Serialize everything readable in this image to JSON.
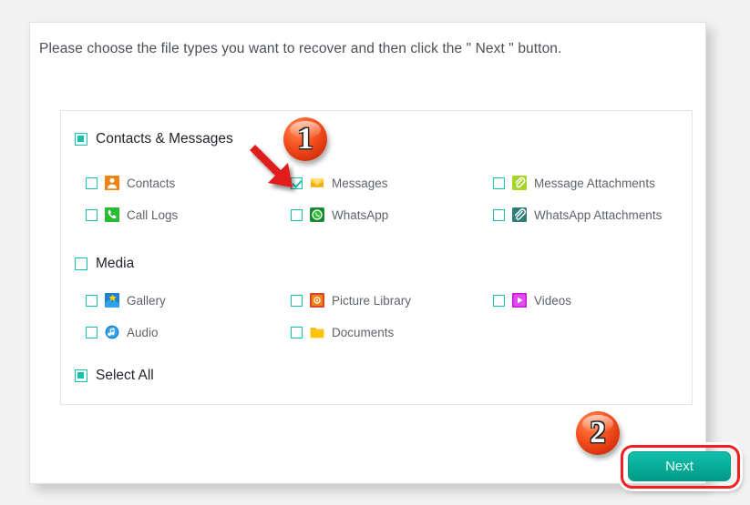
{
  "instruction": "Please choose the file types you want to recover and then click the \" Next \" button.",
  "colors": {
    "accent_teal": "#16c2ac",
    "button_teal": "#06a995",
    "annotation_red": "#f31f1f",
    "badge_orange": "#f6521f",
    "label_gray": "#5e6369",
    "heading_dark": "#20242a"
  },
  "groups": [
    {
      "id": "contacts-messages",
      "label": "Contacts & Messages",
      "checkbox_state": "partial",
      "items": [
        {
          "label": "Contacts",
          "checkbox_state": "unchecked",
          "icon": "contacts-icon"
        },
        {
          "label": "Messages",
          "checkbox_state": "checked",
          "icon": "messages-icon"
        },
        {
          "label": "Message Attachments",
          "checkbox_state": "unchecked",
          "icon": "message-attachments-icon"
        },
        {
          "label": "Call Logs",
          "checkbox_state": "unchecked",
          "icon": "call-logs-icon"
        },
        {
          "label": "WhatsApp",
          "checkbox_state": "unchecked",
          "icon": "whatsapp-icon"
        },
        {
          "label": "WhatsApp Attachments",
          "checkbox_state": "unchecked",
          "icon": "whatsapp-attachments-icon"
        }
      ]
    },
    {
      "id": "media",
      "label": "Media",
      "checkbox_state": "unchecked",
      "items": [
        {
          "label": "Gallery",
          "checkbox_state": "unchecked",
          "icon": "gallery-icon"
        },
        {
          "label": "Picture Library",
          "checkbox_state": "unchecked",
          "icon": "picture-library-icon"
        },
        {
          "label": "Videos",
          "checkbox_state": "unchecked",
          "icon": "videos-icon"
        },
        {
          "label": "Audio",
          "checkbox_state": "unchecked",
          "icon": "audio-icon"
        },
        {
          "label": "Documents",
          "checkbox_state": "unchecked",
          "icon": "documents-icon"
        }
      ]
    }
  ],
  "select_all": {
    "label": "Select All",
    "checkbox_state": "partial"
  },
  "next_button": {
    "label": "Next"
  },
  "annotations": [
    {
      "id": "badge-1",
      "number": "1",
      "points_to": "Messages checkbox"
    },
    {
      "id": "badge-2",
      "number": "2",
      "points_to": "Next button"
    }
  ]
}
